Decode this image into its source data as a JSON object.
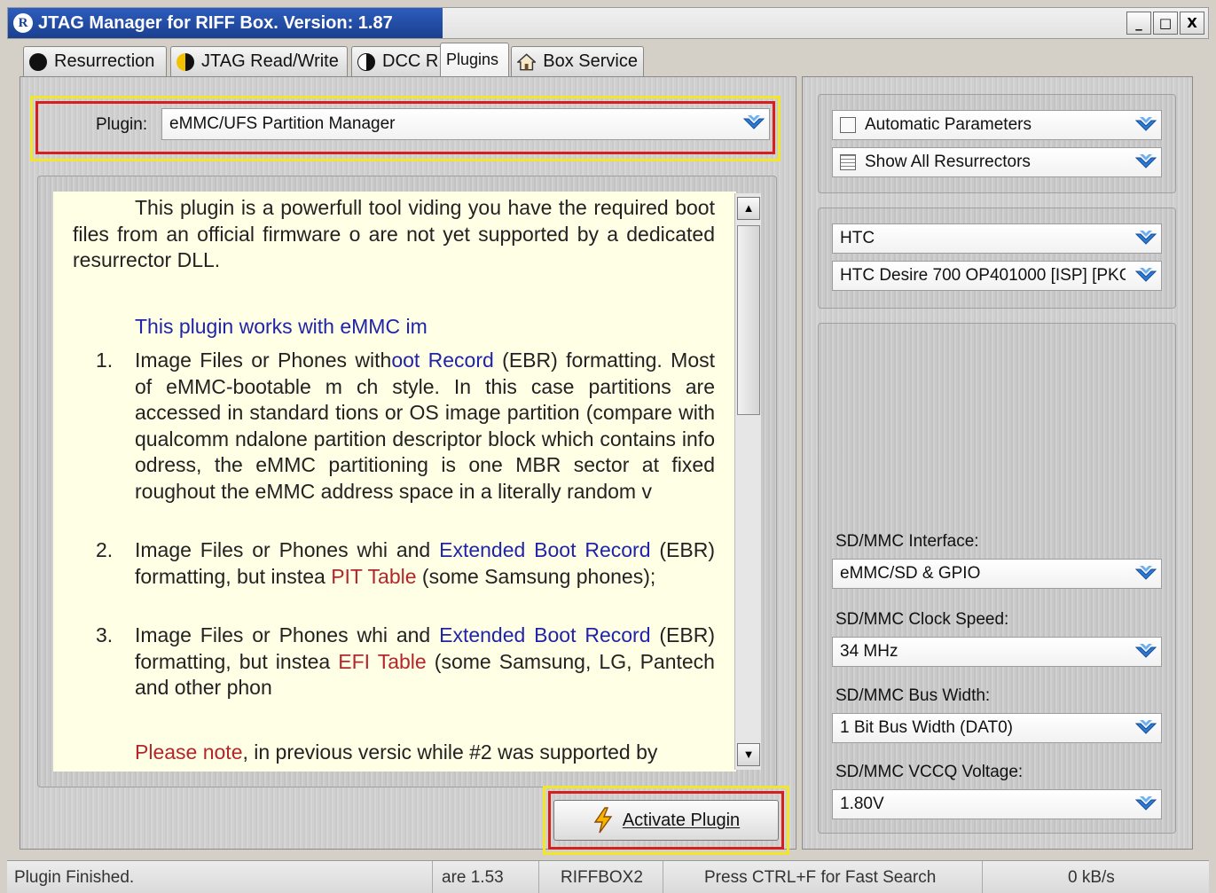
{
  "window": {
    "title": "JTAG Manager for RIFF Box. Version: 1.87",
    "icon_letter": "R",
    "buttons": {
      "minimize": "_",
      "maximize": "□",
      "close": "X"
    }
  },
  "tabs": [
    {
      "label": "Resurrection",
      "icon": "black-circle-icon"
    },
    {
      "label": "JTAG Read/Write",
      "icon": "yellow-half-circle-icon"
    },
    {
      "label": "DCC R",
      "icon": "black-half-circle-icon"
    },
    {
      "label": "Plugins",
      "icon": ""
    },
    {
      "label": "Box Service",
      "icon": "home-icon"
    }
  ],
  "plugin": {
    "label": "Plugin:",
    "selected": "eMMC/UFS Partition Manager"
  },
  "description": {
    "intro": "This plugin is a powerfull tool viding you have the required boot files from an official firmware o are not yet supported by a dedicated resurrector DLL.",
    "works_with": "This plugin works with eMMC im",
    "items": [
      {
        "num": "1.",
        "text_a": "Image Files or Phones with",
        "link": "oot Record",
        "text_b": " (EBR) formatting. Most of eMMC-bootable m ch style. In this case partitions are accessed in standard tions or OS image partition (compare with qualcomm ndalone partition descriptor block which contains info odress, the eMMC partitioning is one MBR sector at fixed roughout the eMMC address space in a literally random v"
      },
      {
        "num": "2.",
        "text_a": "Image Files or Phones whi and ",
        "link": "Extended Boot Record",
        "text_b": " (EBR) formatting, but instea ",
        "red": "PIT Table",
        "text_c": " (some Samsung phones);"
      },
      {
        "num": "3.",
        "text_a": "Image Files or Phones whi and ",
        "link": "Extended Boot Record",
        "text_b": " (EBR) formatting, but instea ",
        "red": "EFI Table",
        "text_c": " (some Samsung, LG, Pantech and other phon"
      }
    ],
    "note_red": "Please note",
    "note_text": ", in previous versic while #2 was supported by"
  },
  "activate_button": {
    "label": "Activate Plugin",
    "icon": "lightning-icon"
  },
  "right": {
    "auto_params": "Automatic Parameters",
    "show_resurrectors": "Show All Resurrectors",
    "manufacturer": "HTC",
    "model": "HTC Desire 700 OP401000 [ISP] [PKG",
    "sdmmc_interface_label": "SD/MMC Interface:",
    "sdmmc_interface": "eMMC/SD & GPIO",
    "clock_label": "SD/MMC Clock Speed:",
    "clock": "34 MHz",
    "bus_label": "SD/MMC Bus Width:",
    "bus": "1 Bit Bus Width (DAT0)",
    "vccq_label": "SD/MMC VCCQ Voltage:",
    "vccq": "1.80V"
  },
  "status": {
    "message": "Plugin Finished.",
    "firmware": "are 1.53",
    "box": "RIFFBOX2",
    "hint": "Press CTRL+F for Fast Search",
    "speed": "0 kB/s"
  },
  "colors": {
    "title_blue": "#1a3f8f",
    "highlight_yellow": "#f2e52a",
    "highlight_red": "#d62020",
    "doc_bg": "#ffffe6",
    "link_blue": "#2024a8",
    "link_red": "#b2262c"
  }
}
